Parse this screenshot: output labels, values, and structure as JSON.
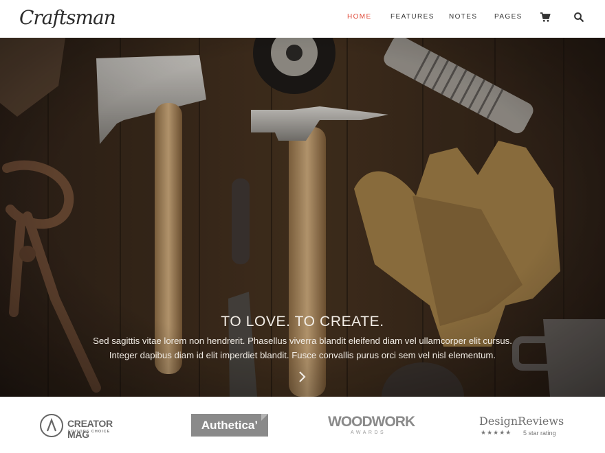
{
  "header": {
    "logo_text": "Craftsman",
    "nav": [
      {
        "label": "HOME",
        "active": true
      },
      {
        "label": "FEATURES",
        "active": false
      },
      {
        "label": "NOTES",
        "active": false
      },
      {
        "label": "PAGES",
        "active": false
      }
    ],
    "icons": [
      "cart-icon",
      "search-icon"
    ],
    "accent_color": "#e04b3a"
  },
  "hero": {
    "title": "TO LOVE. TO CREATE.",
    "line1": "Sed sagittis vitae lorem non hendrerit. Phasellus viverra blandit eleifend diam vel ullamcorper elit cursus.",
    "line2": "Integer dapibus diam id elit imperdiet blandit. Fusce convallis purus orci sem vel nisl elementum.",
    "next_icon": "chevron-right-icon"
  },
  "brands": {
    "creator_mag": {
      "name": "CREATOR MAG",
      "sub": "EDITORS CHOICE"
    },
    "authetica": {
      "name": "Authetica’"
    },
    "woodwork": {
      "name": "WOODWORK",
      "sub": "AWARDS"
    },
    "design_reviews": {
      "name": "DesignReviews",
      "stars": "★★★★★",
      "rating": "5 star rating"
    }
  }
}
